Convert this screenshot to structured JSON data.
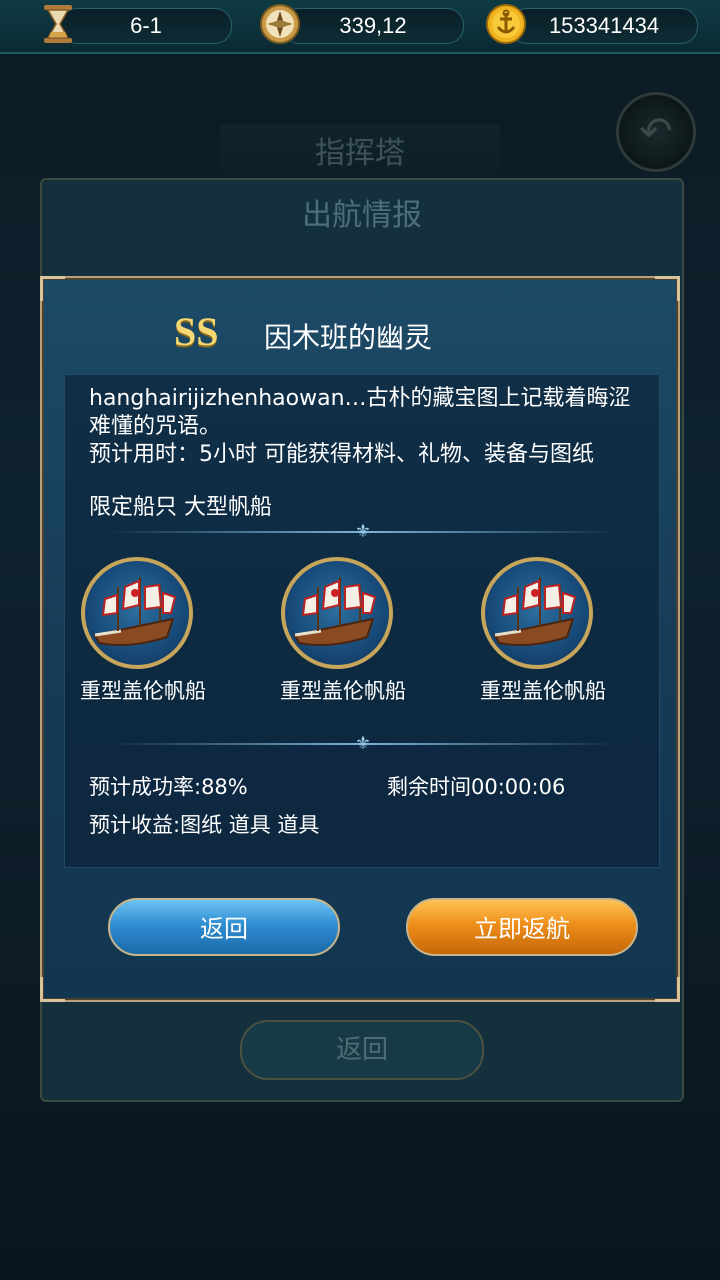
{
  "resources": {
    "level": "6-1",
    "coordinates": "339,12",
    "gold": "153341434",
    "level_icon": "hourglass-icon",
    "coord_icon": "compass-icon",
    "gold_icon": "anchor-coin-icon"
  },
  "background": {
    "screen_title": "指挥塔",
    "panel_title": "出航情报",
    "back_label": "返回"
  },
  "modal": {
    "grade": "SS",
    "title": "因木班的幽灵",
    "description": "hanghairijizhenhaowan…古朴的藏宝图上记载着晦涩难懂的咒语。",
    "time_line": "预计用时：5小时   可能获得材料、礼物、装备与图纸",
    "ship_limit": "限定船只  大型帆船",
    "ships": [
      {
        "name": "重型盖伦帆船"
      },
      {
        "name": "重型盖伦帆船"
      },
      {
        "name": "重型盖伦帆船"
      }
    ],
    "success_rate": "预计成功率:88%",
    "remaining_time": "剩余时间00:00:06",
    "rewards": "预计收益:图纸 道具 道具",
    "back_button": "返回",
    "return_now_button": "立即返航"
  },
  "colors": {
    "modal_border": "#b9a27a",
    "grade_gold": "#f5d873",
    "blue_button": "#2f8ed3",
    "orange_button": "#ee8e1a"
  }
}
